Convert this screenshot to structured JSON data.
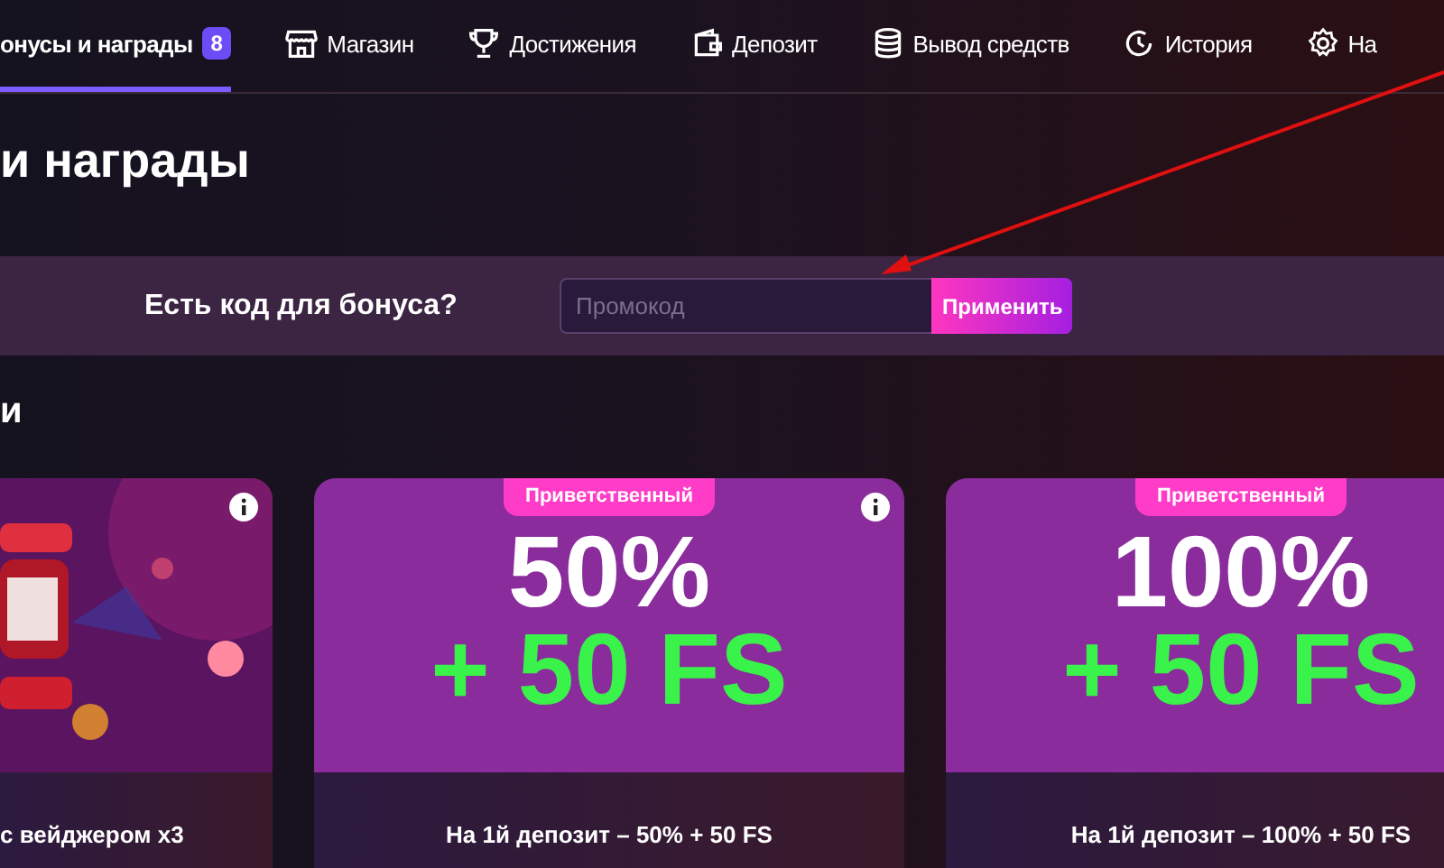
{
  "nav": {
    "tabs": [
      {
        "label": "онусы и награды",
        "badge": "8",
        "selected": true
      },
      {
        "label": "Магазин",
        "selected": false
      },
      {
        "label": "Достижения",
        "selected": false
      },
      {
        "label": "Депозит",
        "selected": false
      },
      {
        "label": "Вывод средств",
        "selected": false
      },
      {
        "label": "История",
        "selected": false
      },
      {
        "label": "На",
        "selected": false
      }
    ]
  },
  "page_title": "и награды",
  "promo": {
    "label": "Есть код для бонуса?",
    "placeholder": "Промокод",
    "button": "Применить"
  },
  "section_title": "и",
  "cards": [
    {
      "kind": "picture",
      "caption": "с вейджером x3",
      "info": true
    },
    {
      "kind": "offer",
      "badge": "Приветственный",
      "headline": "50%",
      "subline": "+ 50 FS",
      "caption": "На 1й депозит – 50% + 50 FS",
      "info": true
    },
    {
      "kind": "offer",
      "badge": "Приветственный",
      "headline": "100%",
      "subline": "+ 50 FS",
      "caption": "На 1й депозит – 100% + 50 FS"
    }
  ]
}
